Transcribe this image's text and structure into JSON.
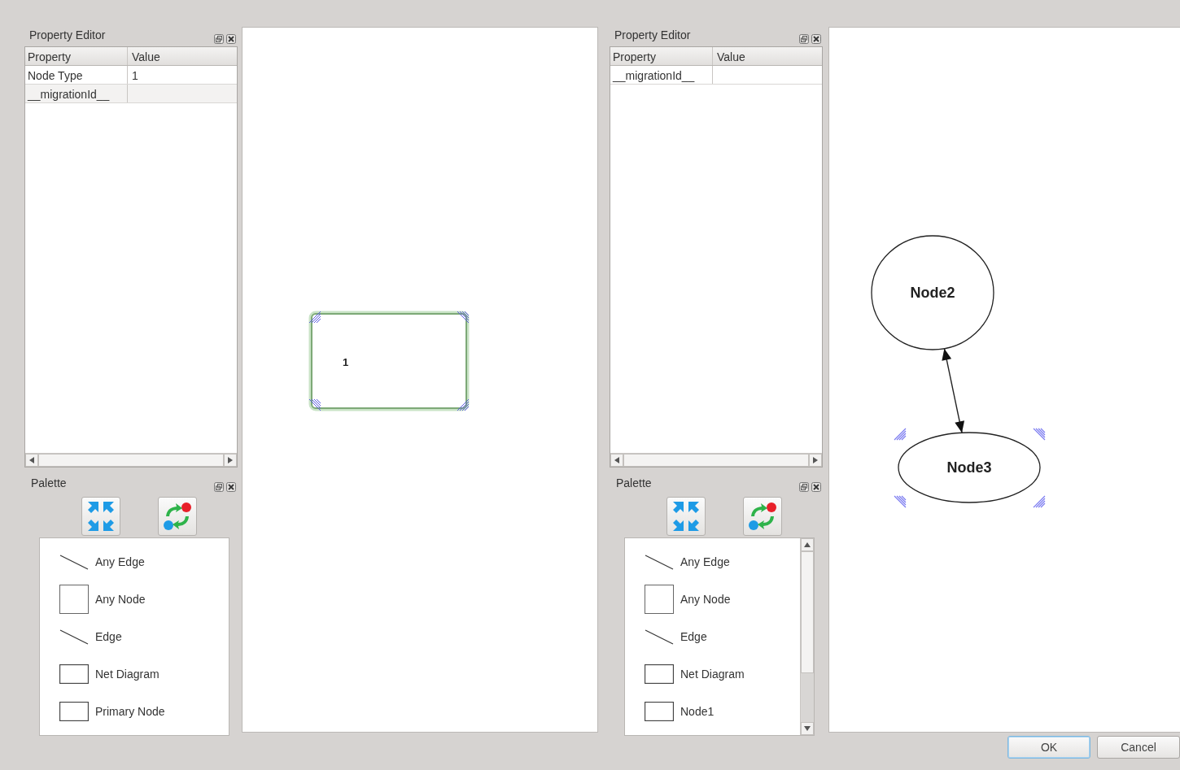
{
  "panels": [
    {
      "property_editor": {
        "title": "Property Editor",
        "columns": [
          "Property",
          "Value"
        ],
        "rows": [
          {
            "property": "Node Type",
            "value": "1"
          },
          {
            "property": "__migrationId__"
          }
        ]
      },
      "palette": {
        "title": "Palette",
        "scrollable": false,
        "items": [
          {
            "kind": "edge",
            "label": "Any Edge"
          },
          {
            "kind": "square",
            "label": "Any Node"
          },
          {
            "kind": "edge",
            "label": "Edge"
          },
          {
            "kind": "rect",
            "label": "Net Diagram"
          },
          {
            "kind": "rect",
            "label": "Primary Node"
          }
        ]
      },
      "diagram": {
        "nodes": [
          {
            "kind": "rect",
            "label": "1",
            "selected": true
          }
        ]
      }
    },
    {
      "property_editor": {
        "title": "Property Editor",
        "columns": [
          "Property",
          "Value"
        ],
        "rows": [
          {
            "property": "__migrationId__"
          }
        ]
      },
      "palette": {
        "title": "Palette",
        "scrollable": true,
        "items": [
          {
            "kind": "edge",
            "label": "Any Edge"
          },
          {
            "kind": "square",
            "label": "Any Node"
          },
          {
            "kind": "edge",
            "label": "Edge"
          },
          {
            "kind": "rect",
            "label": "Net Diagram"
          },
          {
            "kind": "rect",
            "label": "Node1"
          }
        ]
      },
      "diagram": {
        "nodes": [
          {
            "kind": "ellipse",
            "label": "Node2",
            "selected": false
          },
          {
            "kind": "ellipse",
            "label": "Node3",
            "selected": true
          }
        ],
        "edges": [
          {
            "source_arrow": true,
            "target_arrow": true
          }
        ]
      }
    }
  ],
  "buttons": [
    {
      "label": "OK",
      "default": true
    },
    {
      "label": "Cancel",
      "default": false
    }
  ]
}
